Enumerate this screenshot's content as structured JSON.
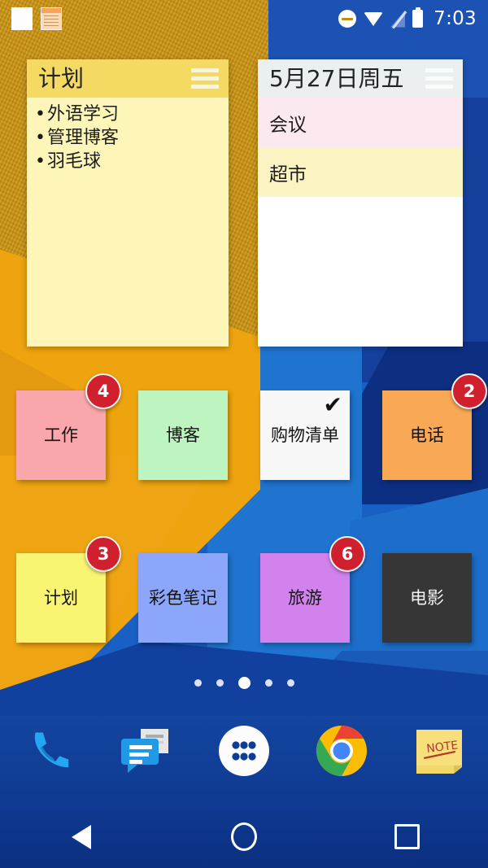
{
  "status_bar": {
    "time": "7:03",
    "notifications": [
      "blank-note-icon",
      "lined-note-icon"
    ],
    "icons": [
      "do-not-disturb-icon",
      "wifi-icon",
      "signal-off-icon",
      "battery-icon"
    ]
  },
  "widgets": {
    "plan": {
      "title": "计划",
      "menu_icon": "hamburger-icon",
      "items": [
        "外语学习",
        "管理博客",
        "羽毛球"
      ],
      "header_color": "#f4da62",
      "body_color": "#fdf6b8"
    },
    "calendar": {
      "title": "5月27日周五",
      "menu_icon": "hamburger-icon",
      "rows": [
        {
          "text": "会议",
          "color": "#fce9ef"
        },
        {
          "text": "超市",
          "color": "#fbf4c2"
        }
      ],
      "header_color": "#eceff0",
      "body_color": "#ffffff"
    }
  },
  "app_grid": {
    "rows": [
      [
        {
          "label": "工作",
          "color": "#f9a7ac",
          "badge": "4",
          "check": ""
        },
        {
          "label": "博客",
          "color": "#bdf4bf",
          "badge": "",
          "check": ""
        },
        {
          "label": "购物清单",
          "color": "#f7f7f7",
          "badge": "",
          "check": "✔"
        },
        {
          "label": "电话",
          "color": "#f9a955",
          "badge": "2",
          "check": ""
        }
      ],
      [
        {
          "label": "计划",
          "color": "#faf473",
          "badge": "3",
          "check": ""
        },
        {
          "label": "彩色笔记",
          "color": "#8ba6fb",
          "badge": "",
          "check": ""
        },
        {
          "label": "旅游",
          "color": "#d182ec",
          "badge": "6",
          "check": ""
        },
        {
          "label": "电影",
          "color": "#363636",
          "badge": "",
          "check": "",
          "dark": true
        }
      ]
    ],
    "badge_color": "#d0202e"
  },
  "page_indicator": {
    "count": 5,
    "active_index": 2
  },
  "dock": {
    "items": [
      "phone-icon",
      "messages-icon",
      "app-drawer-icon",
      "chrome-icon",
      "note-icon"
    ],
    "note_text": "NOTE"
  },
  "nav_bar": {
    "buttons": [
      "back-button",
      "home-button",
      "recents-button"
    ]
  }
}
